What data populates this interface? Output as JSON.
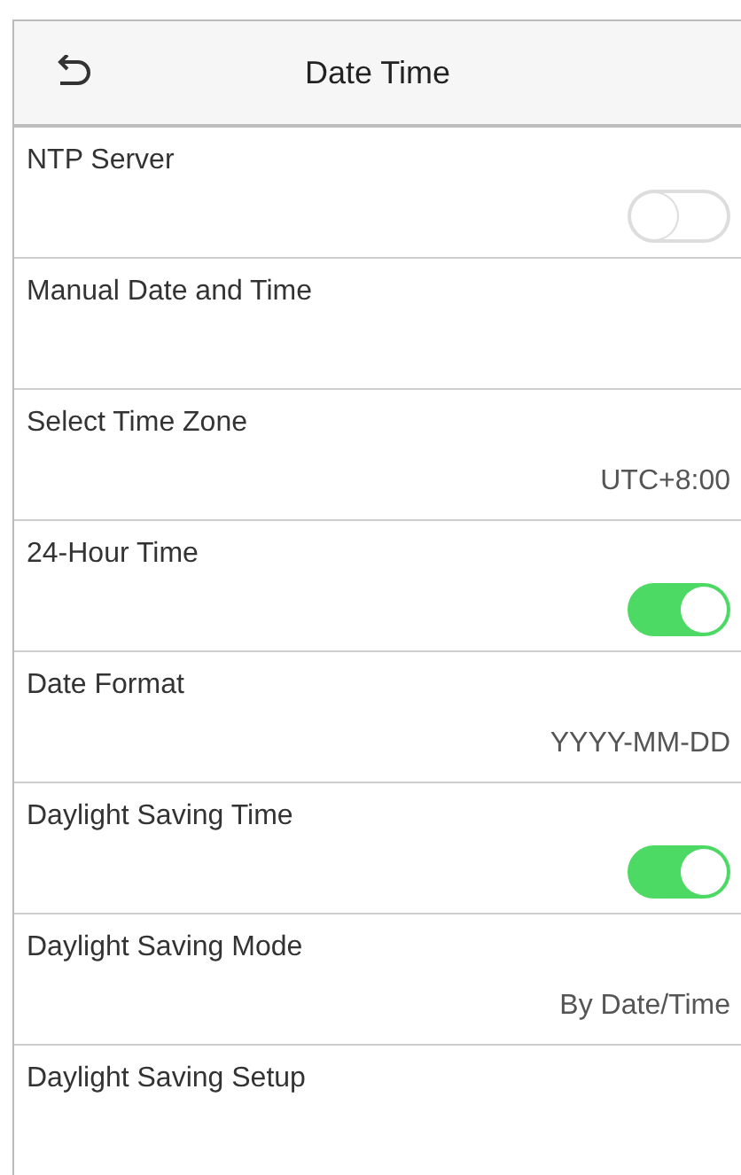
{
  "header": {
    "title": "Date Time"
  },
  "items": [
    {
      "kind": "toggle",
      "label": "NTP Server",
      "on": false
    },
    {
      "kind": "plain",
      "label": "Manual Date and Time"
    },
    {
      "kind": "value",
      "label": "Select Time Zone",
      "value": "UTC+8:00"
    },
    {
      "kind": "toggle",
      "label": "24-Hour Time",
      "on": true
    },
    {
      "kind": "value",
      "label": "Date Format",
      "value": "YYYY-MM-DD"
    },
    {
      "kind": "toggle",
      "label": "Daylight Saving Time",
      "on": true
    },
    {
      "kind": "value",
      "label": "Daylight Saving Mode",
      "value": "By Date/Time"
    },
    {
      "kind": "plain",
      "label": "Daylight Saving Setup"
    }
  ]
}
